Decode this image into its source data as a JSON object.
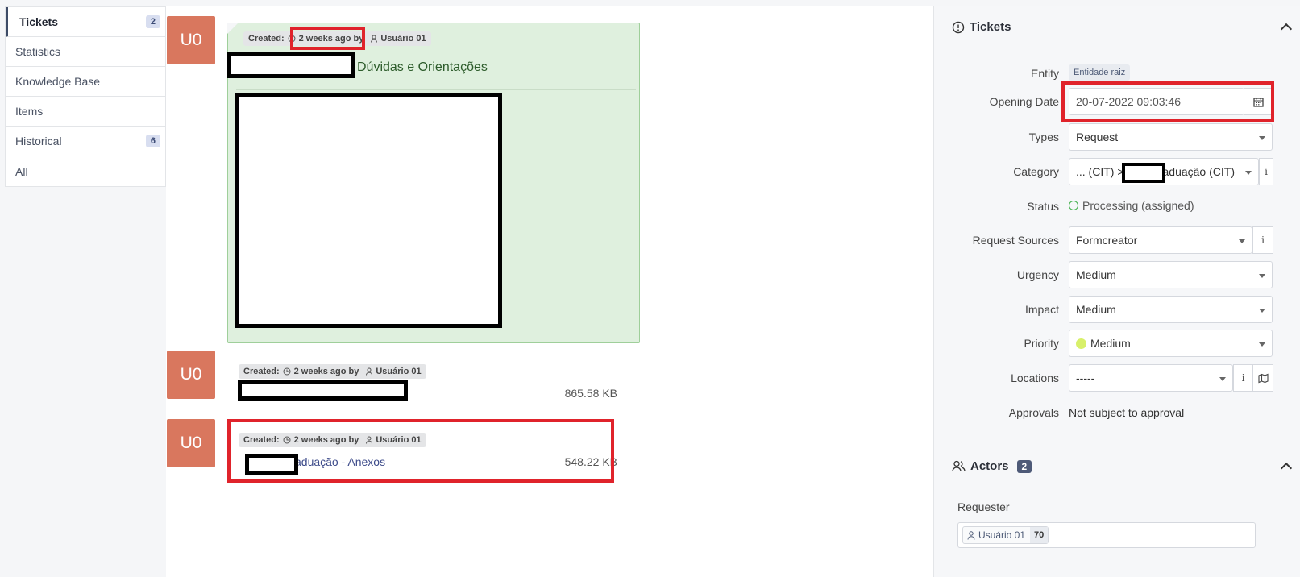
{
  "nav": {
    "items": [
      {
        "label": "Tickets",
        "badge": "2"
      },
      {
        "label": "Statistics",
        "badge": ""
      },
      {
        "label": "Knowledge Base",
        "badge": ""
      },
      {
        "label": "Items",
        "badge": ""
      },
      {
        "label": "Historical",
        "badge": "6"
      },
      {
        "label": "All",
        "badge": ""
      }
    ]
  },
  "timeline": {
    "avatar_initials": "U0",
    "created_label": "Created:",
    "created_when": "2 weeks ago by",
    "created_user": "Usuário 01",
    "followup_title": "Dúvidas e Orientações",
    "doc1_size": "865.58 KB",
    "doc2_name": "aduação - Anexos",
    "doc2_size": "548.22 KB"
  },
  "panel": {
    "title": "Tickets",
    "fields": {
      "entity_label": "Entity",
      "entity_value": "Entidade raiz",
      "opening_label": "Opening Date",
      "opening_value": "20-07-2022 09:03:46",
      "types_label": "Types",
      "types_value": "Request",
      "category_label": "Category",
      "category_value_left": "... (CIT) >",
      "category_value_right": "aduação (CIT)",
      "status_label": "Status",
      "status_value": "Processing (assigned)",
      "sources_label": "Request Sources",
      "sources_value": "Formcreator",
      "urgency_label": "Urgency",
      "urgency_value": "Medium",
      "impact_label": "Impact",
      "impact_value": "Medium",
      "priority_label": "Priority",
      "priority_value": "Medium",
      "locations_label": "Locations",
      "locations_value": "-----",
      "approvals_label": "Approvals",
      "approvals_value": "Not subject to approval"
    },
    "actors_title": "Actors",
    "actors_count": "2",
    "requester_label": "Requester",
    "requester_name": "Usuário 01",
    "requester_count": "70"
  },
  "colors": {
    "avatar": "#d9775e",
    "highlight": "#e0232b",
    "followup_bg": "#dff0de",
    "status_green": "#3fae49",
    "priority_dot": "#d8f06a"
  }
}
